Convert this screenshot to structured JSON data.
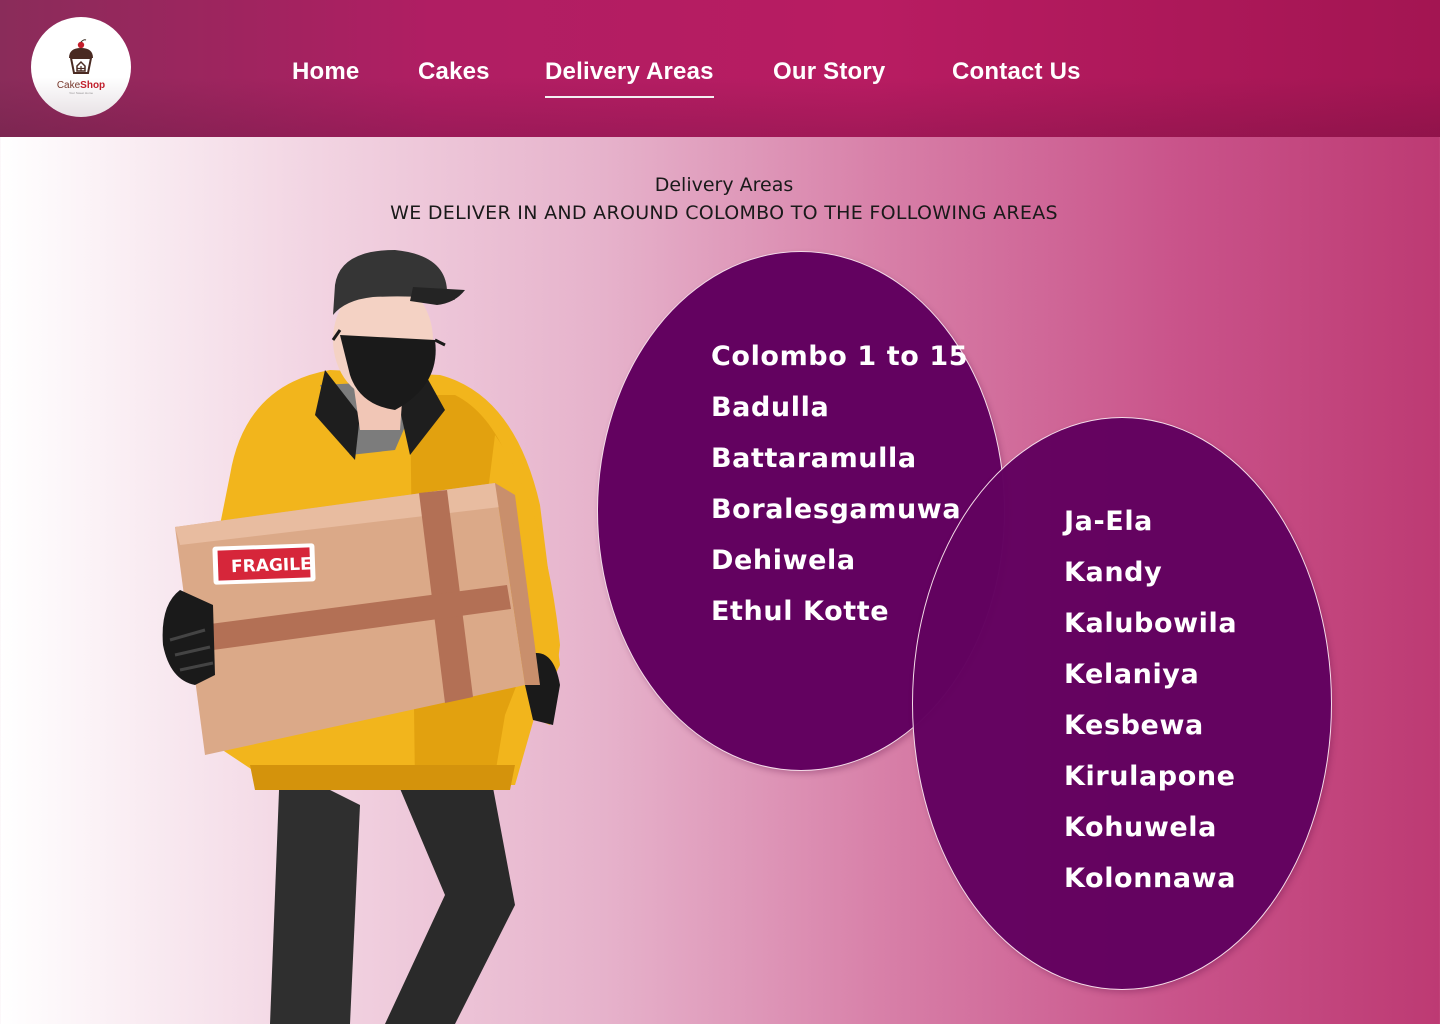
{
  "brand": {
    "logo_text_main": "Cake",
    "logo_text_accent": "Shop",
    "logo_tagline": "Your Sweet Home",
    "logo_icon": "cupcake-house-icon"
  },
  "nav": {
    "items": [
      {
        "label": "Home"
      },
      {
        "label": "Cakes"
      },
      {
        "label": "Delivery Areas"
      },
      {
        "label": "Our Story"
      },
      {
        "label": "Contact Us"
      }
    ],
    "active": "Delivery Areas"
  },
  "page": {
    "title": "Delivery Areas",
    "subtitle": "WE DELIVER IN AND AROUND COLOMBO TO THE FOLLOWING AREAS"
  },
  "illustration": {
    "box_label": "FRAGILE"
  },
  "areas": {
    "group1": [
      "Colombo 1 to 15",
      "Badulla",
      "Battaramulla",
      "Boralesgamuwa",
      "Dehiwela",
      "Ethul Kotte"
    ],
    "group2": [
      "Ja-Ela",
      "Kandy",
      "Kalubowila",
      "Kelaniya",
      "Kesbewa",
      "Kirulapone",
      "Kohuwela",
      "Kolonnawa"
    ]
  },
  "colors": {
    "header": "#b01e63",
    "bubble": "#630260",
    "page_accent": "#bd3a73",
    "nav_text": "#ffffff"
  }
}
